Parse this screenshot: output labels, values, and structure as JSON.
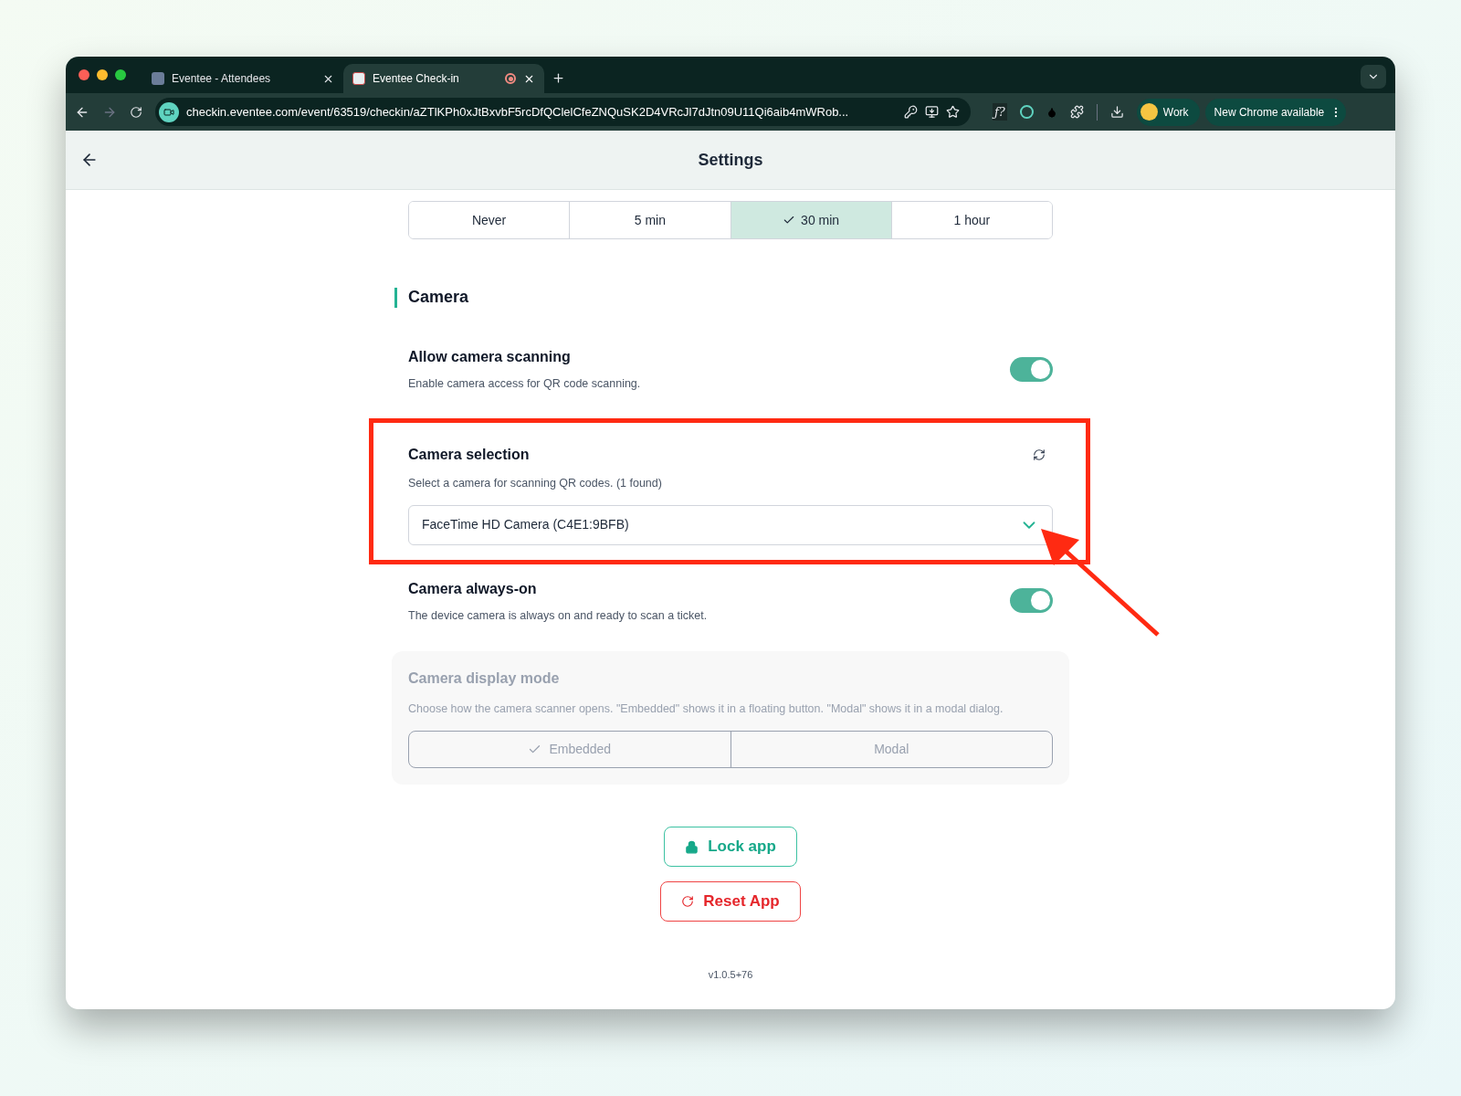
{
  "browser": {
    "tabs": [
      {
        "title": "Eventee - Attendees",
        "selected": false,
        "recording": false
      },
      {
        "title": "Eventee Check-in",
        "selected": true,
        "recording": true
      }
    ],
    "url": "checkin.eventee.com/event/63519/checkin/aZTlKPh0xJtBxvbF5rcDfQClelCfeZNQuSK2D4VRcJl7dJtn09U11Qi6aib4mWRob...",
    "extension_glyph": "ƒ?",
    "profile": "Work",
    "update": "New Chrome available"
  },
  "header": {
    "title": "Settings"
  },
  "timeout_options": [
    {
      "label": "Never",
      "selected": false
    },
    {
      "label": "5 min",
      "selected": false
    },
    {
      "label": "30 min",
      "selected": true
    },
    {
      "label": "1 hour",
      "selected": false
    }
  ],
  "section": {
    "title": "Camera"
  },
  "settings": [
    {
      "kind": "toggle",
      "title": "Allow camera scanning",
      "description": "Enable camera access for QR code scanning.",
      "on": true
    },
    {
      "kind": "select",
      "title": "Camera selection",
      "description": "Select a camera for scanning QR codes. (1 found)",
      "value": "FaceTime HD Camera (C4E1:9BFB)",
      "highlighted": true
    },
    {
      "kind": "toggle",
      "title": "Camera always-on",
      "description": "The device camera is always on and ready to scan a ticket.",
      "on": true
    },
    {
      "kind": "segmented",
      "title": "Camera display mode",
      "description": "Choose how the camera scanner opens. \"Embedded\" shows it in a floating button. \"Modal\" shows it in a modal dialog.",
      "disabled": true,
      "options": [
        {
          "label": "Embedded",
          "selected": true
        },
        {
          "label": "Modal",
          "selected": false
        }
      ]
    }
  ],
  "actions": [
    {
      "kind": "lock",
      "label": "Lock app"
    },
    {
      "kind": "reset",
      "label": "Reset App"
    }
  ],
  "version": "v1.0.5+76"
}
